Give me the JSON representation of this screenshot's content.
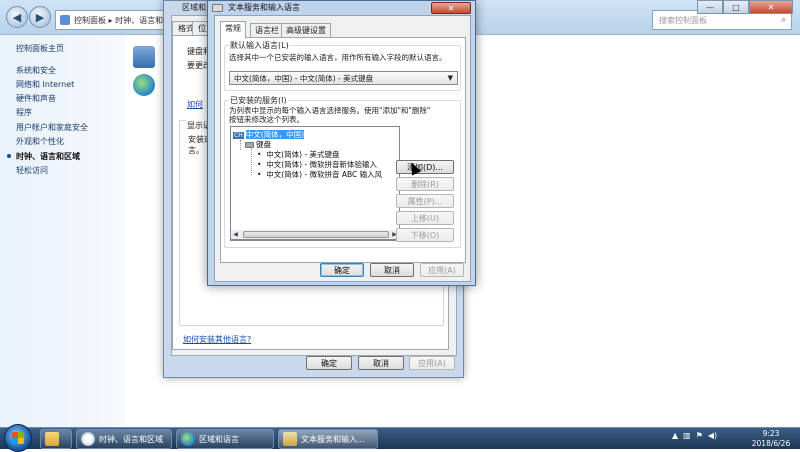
{
  "control_panel": {
    "address": "控制面板 ▸ 时钟、语言和区域 ▸",
    "search_placeholder": "搜索控制面板",
    "win_min": "—",
    "win_max": "□",
    "win_close": "✕",
    "sidebar": [
      {
        "label": "控制面板主页",
        "active": false
      },
      {
        "label": "系统和安全",
        "active": false
      },
      {
        "label": "网络和 Internet",
        "active": false
      },
      {
        "label": "硬件和声音",
        "active": false
      },
      {
        "label": "程序",
        "active": false
      },
      {
        "label": "用户帐户和家庭安全",
        "active": false
      },
      {
        "label": "外观和个性化",
        "active": false
      },
      {
        "label": "时钟、语言和区域",
        "active": true
      },
      {
        "label": "轻松访问",
        "active": false
      }
    ]
  },
  "region_dialog": {
    "title": "区域和",
    "tabs": [
      "格式",
      "位置"
    ],
    "text_keyboard": "键盘和",
    "text_required": "要更改",
    "link_change": "如何",
    "text_display": "显示语",
    "text_install1": "安装或",
    "text_install2": "言。",
    "link_install": "如何安装其他语言?",
    "ok": "确定",
    "cancel": "取消",
    "apply": "应用(A)"
  },
  "text_services": {
    "title": "文本服务和输入语言",
    "close": "✕",
    "tabs": [
      "常规",
      "语言栏",
      "高级键设置"
    ],
    "default_lang_label": "默认输入语言(L)",
    "default_lang_desc": "选择其中一个已安装的输入语言，用作所有输入字段的默认语言。",
    "default_lang_value": "中文(简体，中国) - 中文(简体) - 美式键盘",
    "installed_label": "已安装的服务(I)",
    "installed_desc_1": "为列表中显示的每个输入语言选择服务。使用\"添加\"和\"删除\"",
    "installed_desc_2": "按钮来修改这个列表。",
    "tree": {
      "root": "中文(简体，中国)",
      "root_badge": "CH",
      "group": "键盘",
      "items": [
        "中文(简体) - 美式键盘",
        "中文(简体) - 微软拼音新体验输入",
        "中文(简体) - 微软拼音 ABC 输入风"
      ]
    },
    "buttons": {
      "add": "添加(D)...",
      "remove": "删除(R)",
      "properties": "属性(P)...",
      "move_up": "上移(U)",
      "move_down": "下移(O)"
    },
    "ok": "确定",
    "cancel": "取消",
    "apply": "应用(A)"
  },
  "taskbar": {
    "items": [
      {
        "label": "",
        "active": false
      },
      {
        "label": "时钟、语言和区域",
        "active": false
      },
      {
        "label": "区域和语言",
        "active": false
      },
      {
        "label": "文本服务和输入...",
        "active": true
      }
    ],
    "time": "9:23",
    "date": "2018/6/26"
  }
}
